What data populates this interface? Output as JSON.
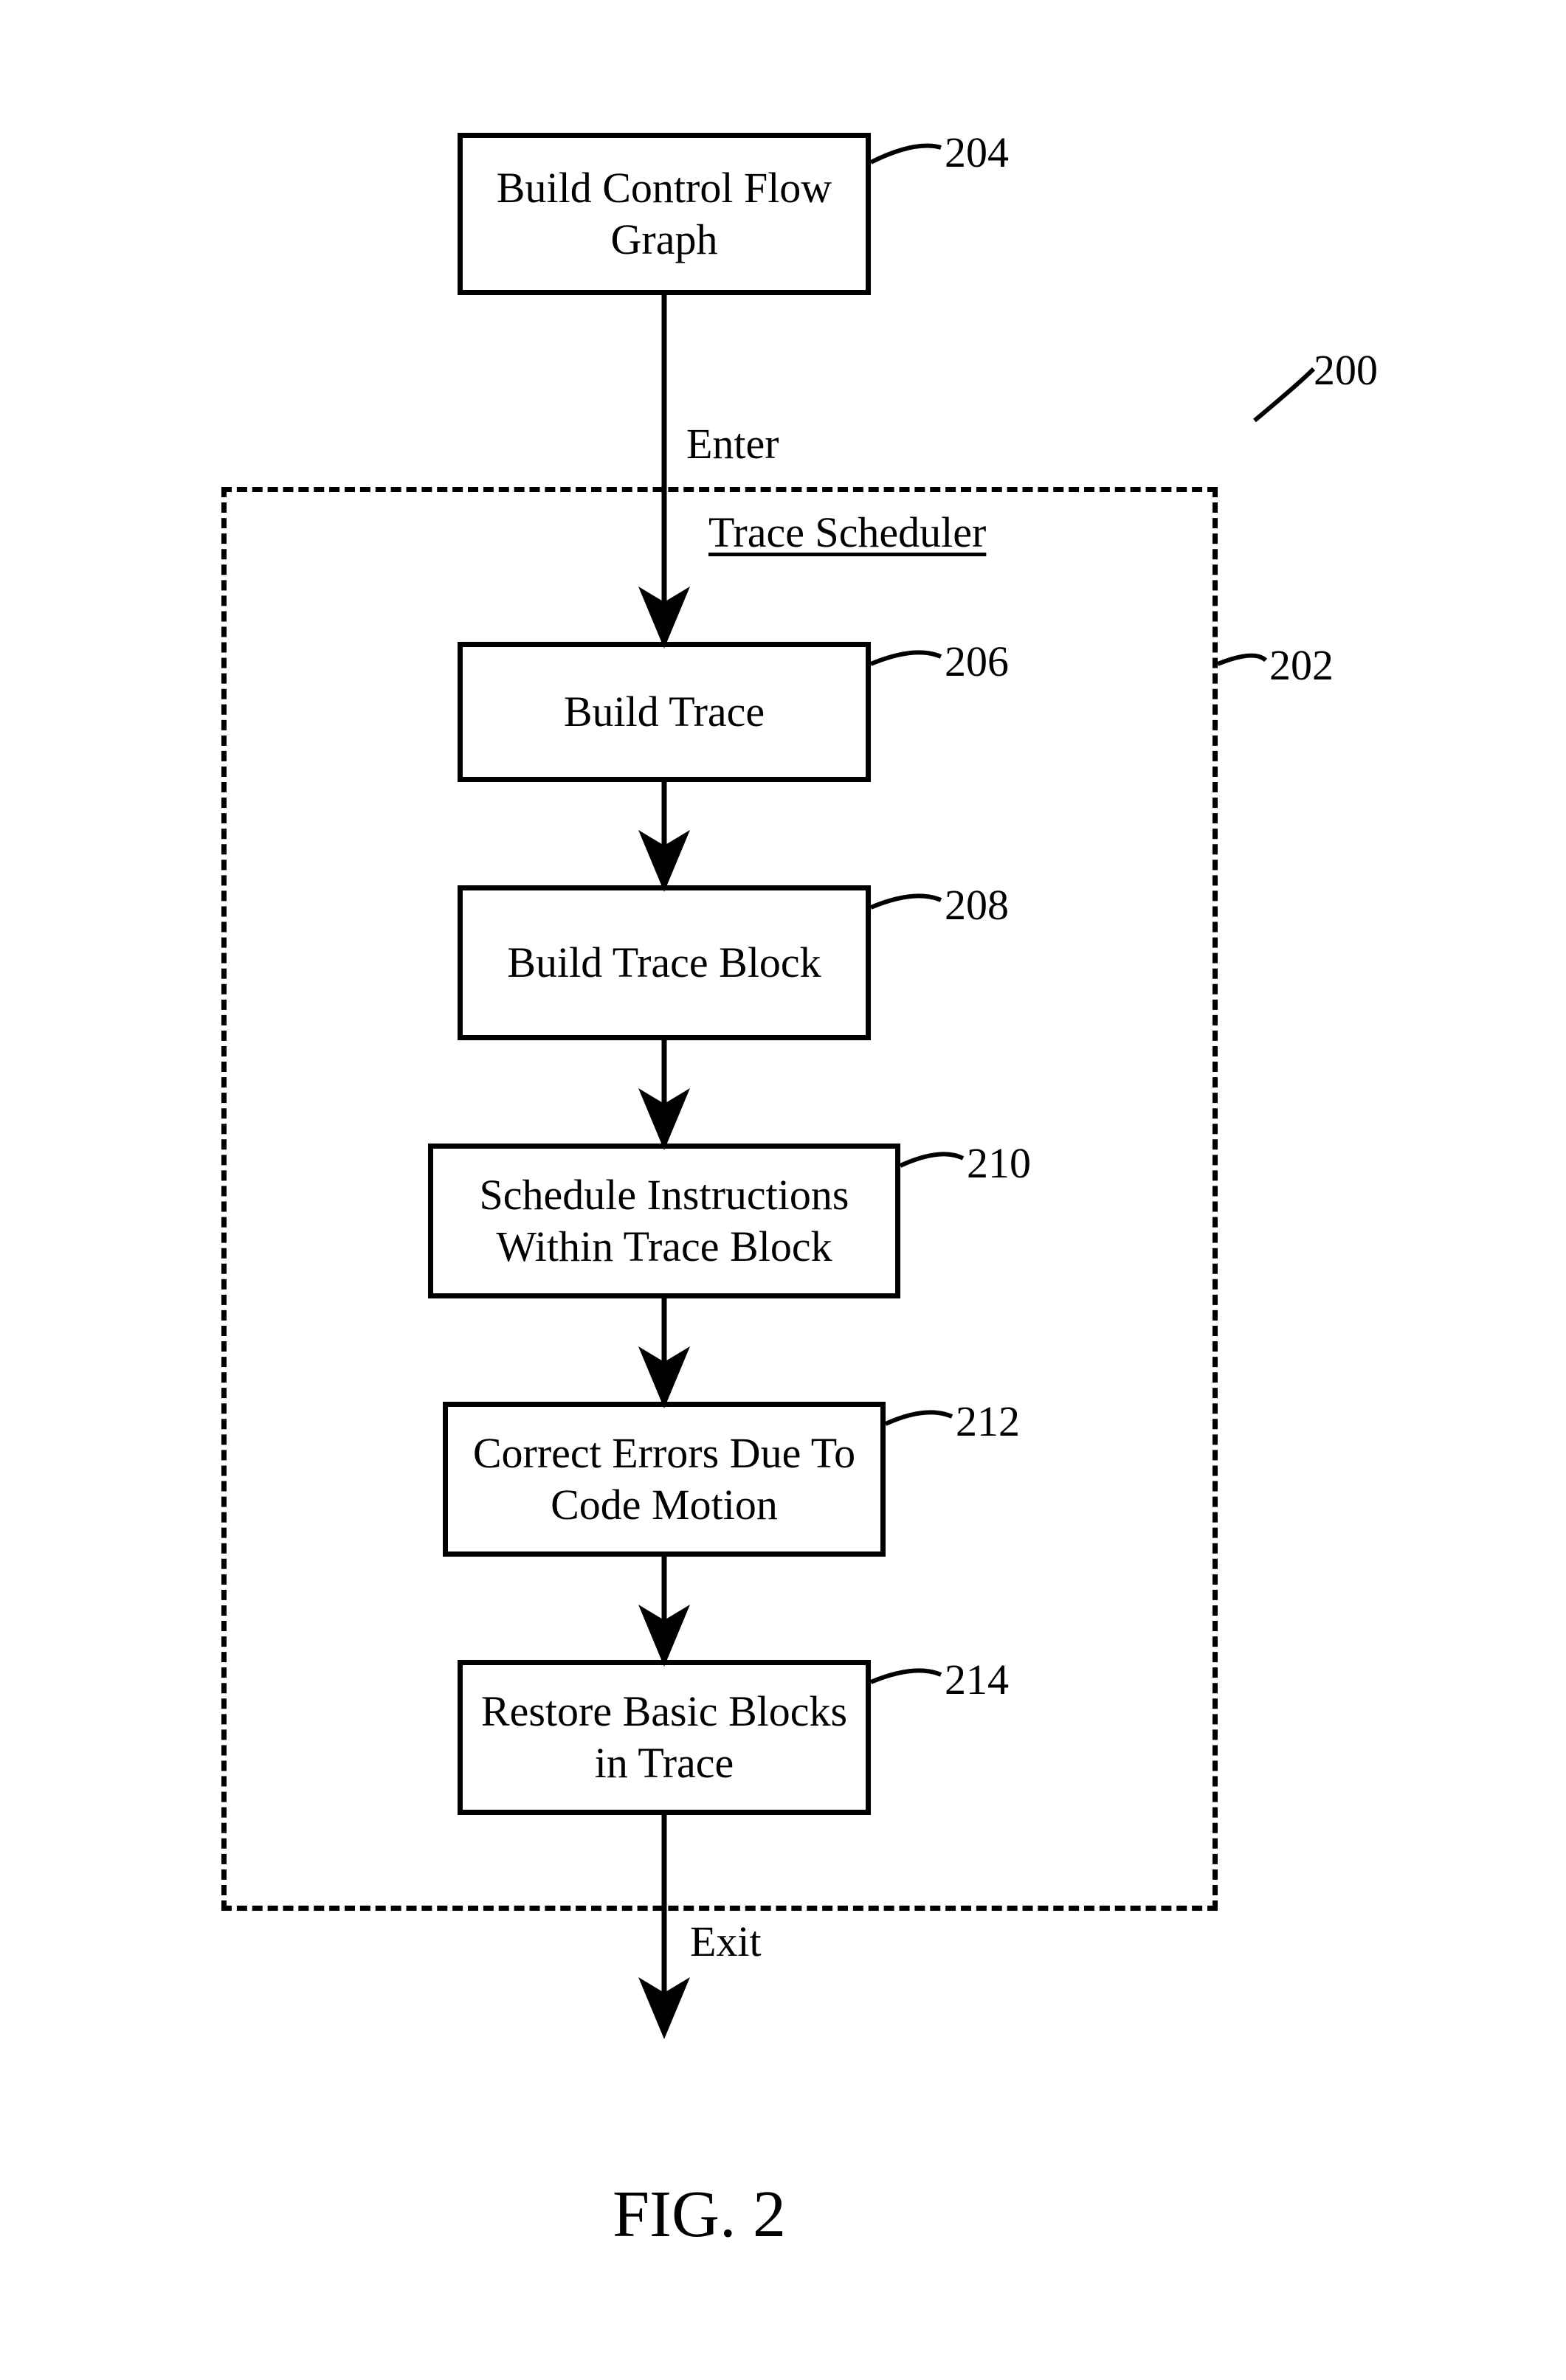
{
  "figure_caption": "FIG. 2",
  "labels": {
    "enter": "Enter",
    "exit": "Exit",
    "scheduler_title": "Trace Scheduler",
    "ref_200": "200",
    "ref_202": "202",
    "ref_204": "204",
    "ref_206": "206",
    "ref_208": "208",
    "ref_210": "210",
    "ref_212": "212",
    "ref_214": "214"
  },
  "boxes": {
    "b204": "Build Control Flow Graph",
    "b206": "Build Trace",
    "b208": "Build Trace Block",
    "b210": "Schedule Instructions Within Trace Block",
    "b212": "Correct Errors Due To Code Motion",
    "b214": "Restore Basic Blocks in Trace"
  }
}
